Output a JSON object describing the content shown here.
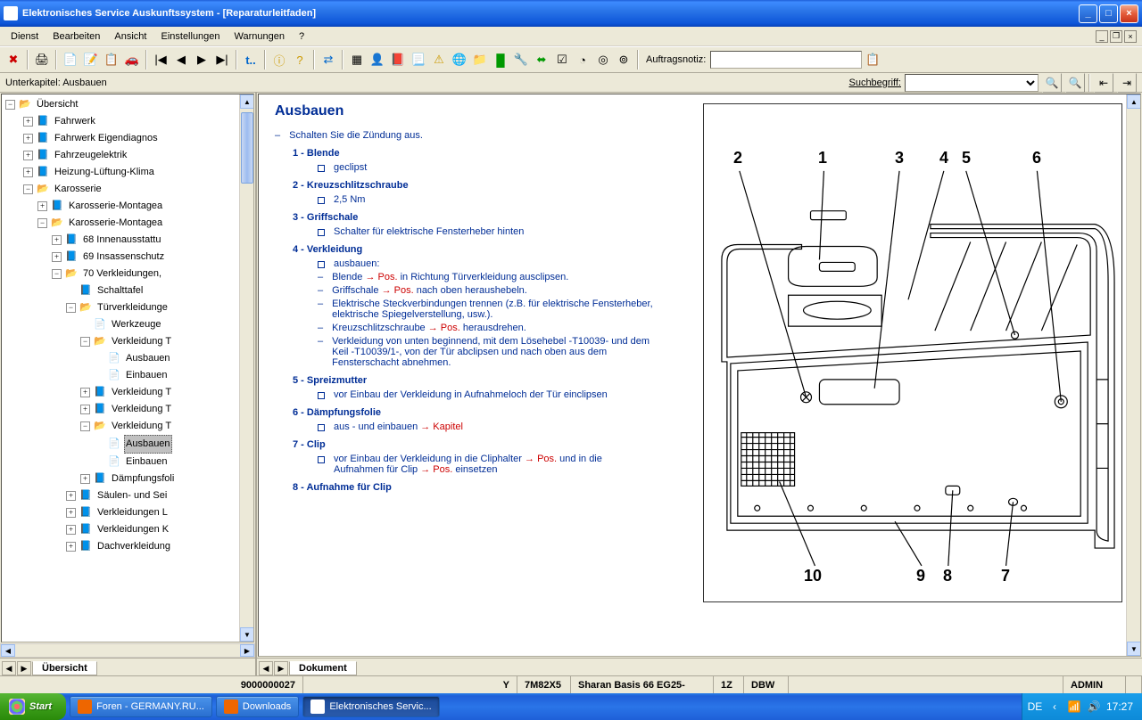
{
  "titlebar": {
    "title": "Elektronisches Service Auskunftssystem - [Reparaturleitfaden]"
  },
  "menu": {
    "items": [
      "Dienst",
      "Bearbeiten",
      "Ansicht",
      "Einstellungen",
      "Warnungen",
      "?"
    ]
  },
  "toolbar": {
    "auftragsnotiz_label": "Auftragsnotiz:"
  },
  "subchapter": {
    "left": "Unterkapitel: Ausbauen",
    "search_label": "Suchbegriff:"
  },
  "tree": {
    "root": "Übersicht",
    "items": [
      {
        "d": 1,
        "e": "+",
        "i": "book-blue",
        "t": "Fahrwerk"
      },
      {
        "d": 1,
        "e": "+",
        "i": "book-blue",
        "t": "Fahrwerk Eigendiagnos"
      },
      {
        "d": 1,
        "e": "+",
        "i": "book-blue",
        "t": "Fahrzeugelektrik"
      },
      {
        "d": 1,
        "e": "+",
        "i": "book-blue",
        "t": "Heizung-Lüftung-Klima"
      },
      {
        "d": 1,
        "e": "-",
        "i": "book-open",
        "t": "Karosserie"
      },
      {
        "d": 2,
        "e": "+",
        "i": "book-blue",
        "t": "Karosserie-Montagea"
      },
      {
        "d": 2,
        "e": "-",
        "i": "book-open",
        "t": "Karosserie-Montagea"
      },
      {
        "d": 3,
        "e": "+",
        "i": "book-blue",
        "t": "68 Innenausstattu"
      },
      {
        "d": 3,
        "e": "+",
        "i": "book-blue",
        "t": "69 Insassenschutz"
      },
      {
        "d": 3,
        "e": "-",
        "i": "book-open",
        "t": "70 Verkleidungen,"
      },
      {
        "d": 4,
        "e": "",
        "i": "book-blue",
        "t": "Schalttafel"
      },
      {
        "d": 4,
        "e": "-",
        "i": "book-open",
        "t": "Türverkleidunge"
      },
      {
        "d": 5,
        "e": "",
        "i": "page",
        "t": "Werkzeuge"
      },
      {
        "d": 5,
        "e": "-",
        "i": "book-open",
        "t": "Verkleidung T"
      },
      {
        "d": 6,
        "e": "",
        "i": "page",
        "t": "Ausbauen"
      },
      {
        "d": 6,
        "e": "",
        "i": "page",
        "t": "Einbauen"
      },
      {
        "d": 5,
        "e": "+",
        "i": "book-blue",
        "t": "Verkleidung T"
      },
      {
        "d": 5,
        "e": "+",
        "i": "book-blue",
        "t": "Verkleidung T"
      },
      {
        "d": 5,
        "e": "-",
        "i": "book-open",
        "t": "Verkleidung T"
      },
      {
        "d": 6,
        "e": "",
        "i": "page",
        "t": "Ausbauen",
        "sel": true
      },
      {
        "d": 6,
        "e": "",
        "i": "page",
        "t": "Einbauen"
      },
      {
        "d": 5,
        "e": "+",
        "i": "book-blue",
        "t": "Dämpfungsfoli"
      },
      {
        "d": 4,
        "e": "+",
        "i": "book-blue",
        "t": "Säulen- und Sei"
      },
      {
        "d": 4,
        "e": "+",
        "i": "book-blue",
        "t": "Verkleidungen L"
      },
      {
        "d": 4,
        "e": "+",
        "i": "book-blue",
        "t": "Verkleidungen K"
      },
      {
        "d": 4,
        "e": "+",
        "i": "book-blue",
        "t": "Dachverkleidung"
      }
    ]
  },
  "left_tab": "Übersicht",
  "right_tab": "Dokument",
  "doc": {
    "title": "Ausbauen",
    "intro": "Schalten Sie die Zündung aus.",
    "parts": [
      {
        "n": "1",
        "t": "Blende",
        "subs": [
          {
            "k": "sq",
            "t": "geclipst"
          }
        ]
      },
      {
        "n": "2",
        "t": "Kreuzschlitzschraube",
        "subs": [
          {
            "k": "sq",
            "t": "2,5 Nm"
          }
        ]
      },
      {
        "n": "3",
        "t": "Griffschale",
        "subs": [
          {
            "k": "sq",
            "t": "Schalter für elektrische Fensterheber hinten"
          }
        ]
      },
      {
        "n": "4",
        "t": "Verkleidung",
        "subs": [
          {
            "k": "sq",
            "t": "ausbauen:"
          },
          {
            "k": "d",
            "pre": "Blende ",
            "r": "→ Pos.",
            "post": " in Richtung Türverkleidung ausclipsen."
          },
          {
            "k": "d",
            "pre": "Griffschale ",
            "r": "→ Pos.",
            "post": " nach oben heraushebeln."
          },
          {
            "k": "d",
            "pre": "",
            "r": "",
            "post": "Elektrische Steckverbindungen trennen (z.B. für elektrische Fensterheber, elektrische Spiegelverstellung, usw.)."
          },
          {
            "k": "d",
            "pre": "Kreuzschlitzschraube ",
            "r": "→ Pos.",
            "post": " herausdrehen."
          },
          {
            "k": "d",
            "pre": "",
            "r": "",
            "post": "Verkleidung von unten beginnend, mit dem Lösehebel -T10039- und dem Keil -T10039/1-, von der Tür abclipsen und nach oben aus dem Fensterschacht abnehmen."
          }
        ]
      },
      {
        "n": "5",
        "t": "Spreizmutter",
        "subs": [
          {
            "k": "sq",
            "t": "vor Einbau der Verkleidung in Aufnahmeloch der Tür einclipsen"
          }
        ]
      },
      {
        "n": "6",
        "t": "Dämpfungsfolie",
        "subs": [
          {
            "k": "sq",
            "pre": "aus - und einbauen ",
            "r": "→ Kapitel",
            "post": ""
          }
        ]
      },
      {
        "n": "7",
        "t": "Clip",
        "subs": [
          {
            "k": "sq",
            "pre": "vor Einbau der Verkleidung in die Cliphalter ",
            "r": "→ Pos.",
            "mid": " und in die Aufnahmen für Clip ",
            "r2": "→ Pos.",
            "post": " einsetzen"
          }
        ]
      },
      {
        "n": "8",
        "t": "Aufnahme für Clip",
        "subs": []
      }
    ],
    "labels": [
      "1",
      "2",
      "3",
      "4",
      "5",
      "6",
      "7",
      "8",
      "9",
      "10"
    ]
  },
  "status": {
    "ordernr": "9000000027",
    "y": "Y",
    "code": "7M82X5",
    "vehicle": "Sharan Basis 66 EG25-",
    "c1": "1Z",
    "c2": "DBW",
    "user": "ADMIN"
  },
  "taskbar": {
    "start": "Start",
    "tasks": [
      "Foren - GERMANY.RU...",
      "Downloads",
      "Elektronisches Servic..."
    ],
    "lang": "DE",
    "clock": "17:27"
  }
}
